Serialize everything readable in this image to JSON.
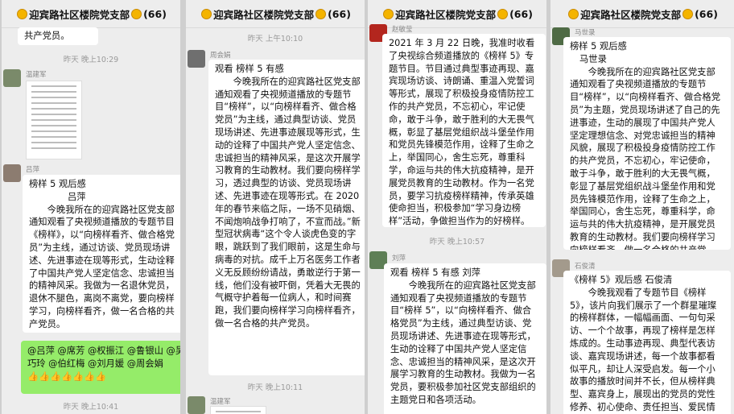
{
  "group_title": "迎宾路社区楼院党支部",
  "member_count": "(66)",
  "p1": {
    "top_text": "共产党员。",
    "ts1": "昨天 晚上10:29",
    "name1": "温建军",
    "name2": "吕萍",
    "b_title": "榜样 5 观后感",
    "b_author": "吕萍",
    "b_body": "今晚我所在的迎宾路社区党支部通知观看了央视频道播放的专题节目《榜样》，以“向榜样看齐、做合格党员”为主线，通过访谈、党员现场讲述、先进事迹在现等形式，生动诠释了中国共产党人坚定信念、忠诚担当的精神风采。我做为一名退休党员，退休不腿色，离岗不离党，要向榜样学习，向榜样看齐，做一名合格的共产党员。",
    "green": "@吕萍 @席芳 @权振江 @鲁银山 @吴巧玲 @伯红梅 @刘月媛 @周会娟",
    "ts2": "昨天 晚上10:41"
  },
  "p2": {
    "ts1": "昨天 上午10:10",
    "name1": "周会娟",
    "b_title": "观看  榜样 5 有感",
    "b_body": "今晚我所在的迎宾路社区党支部通知观看了央视频道播放的专题节目“榜样”，以“向榜样看齐、做合格党员”为主线，通过典型访谈、党员现场讲述、先进事迹展现等形式，生动的诠释了中国共产党人坚定信念、忠诚担当的精神风采，是这次开展学习教育的生动教材。我们要向榜样学习，透过典型的访谈、党员现场讲述、先进事迹在现等形式。在 2020 年的春节来临之际，一场不见硝烟、不闻炮响战争打响了，不宣而战。”新型冠状病毒“这个令人谈虎色变的字眼，跳跃到了我们眼前，这是生命与病毒的对抗。成千上万名医务工作者义无反顾纷纷请战，勇敢逆行于第一线，他们没有被吓倒，凭着大无畏的气概守护着每一位病人，和时间赛跑，我们要向榜样学习向榜样看齐，做一名合格的共产党员。",
    "ts2": "昨天 晚上10:11",
    "name2": "温建军"
  },
  "p3": {
    "name1": "赵敏莹",
    "b1_body": "2021 年 3 月 22 日晚，我准时收看了央视综合频道播放的《榜样 5》专题节目。节目通过典型事迹再现、嘉宾现场访谈、诗朗诵、重温入党誓词等形式，展现了积极投身疫情防控工作的共产党员，不忘初心，牢记使命，敢于斗争，敢于胜利的大无畏气概，彰显了基层党组织战斗堡垒作用和党员先锋模范作用，诠释了生命之上，举国同心，舍生忘死，尊重科学，命运与共的伟大抗疫精神，是开展党员教育的生动教材。作为一名党员，要学习抗疫榜样精神，传承英雄使命担当，积极参加“学习身边榜样”活动，争做担当作为的好榜样。",
    "ts1": "昨天 晚上10:57",
    "name2": "刘萍",
    "b2_title": "观看  榜样 5 有感    刘萍",
    "b2_body": "今晚我所在的迎宾路社区党支部通知观看了央视频道播放的专题节目“榜样 5”，以“向榜样看齐、做合格党员”为主线，通过典型访谈、党员现场讲述、先进事迹在现等形式，生动的诠释了中国共产党人坚定信念、忠诚担当的精神风采，是这次开展学习教育的生动教材。我做为一名党员，要积极参加社区党支部组织的主题党日和各项活动。"
  },
  "p4": {
    "name1": "马世录",
    "b1_title": "榜样 5 观后感",
    "b1_author": "马世录",
    "b1_body": "今晚我所在的迎宾路社区党支部通知观看了央视频道播放的专题节目“榜样”，以“向榜样看齐、做合格党员”为主题，党员现场讲述了自己的先进事迹，生动的展现了中国共产党人坚定理想信念、对党忠诚担当的精神风貌，展现了积极投身疫情防控工作的共产党员，不忘初心，牢记使命，敢于斗争，敢于胜利的大无畏气概，彰显了基层党组织战斗堡垒作用和党员先锋模范作用，诠释了生命之上，举国同心，舍生忘死，尊重科学，命运与共的伟大抗疫精神，是开展党员教育的生动教材。我们要向榜样学习向榜样看齐，做一名合格的共产党员。",
    "name2": "石俊清",
    "b2_title": "《榜样 5》观后感    石俊清",
    "b2_body": "今晚我观看了专题节目《榜样 5》，该片向我们展示了一个群星璀璨的榜样群体，一幅幅画面、一句句采访、一个个故事，再现了榜样是怎样炼成的。生动事迹再现、典型代表访谈、嘉宾现场讲述，每一个故事都看似平凡，却让人深受启发。每一个小故事的播放时间并不长，但从榜样典型、嘉宾身上，展现出的党员的党性修养、初心使命、责任担当、爱民情怀等等，都令人感"
  },
  "colors": {
    "bubble": "#ffffff",
    "mine": "#95ec69",
    "bg": "#ededed"
  }
}
